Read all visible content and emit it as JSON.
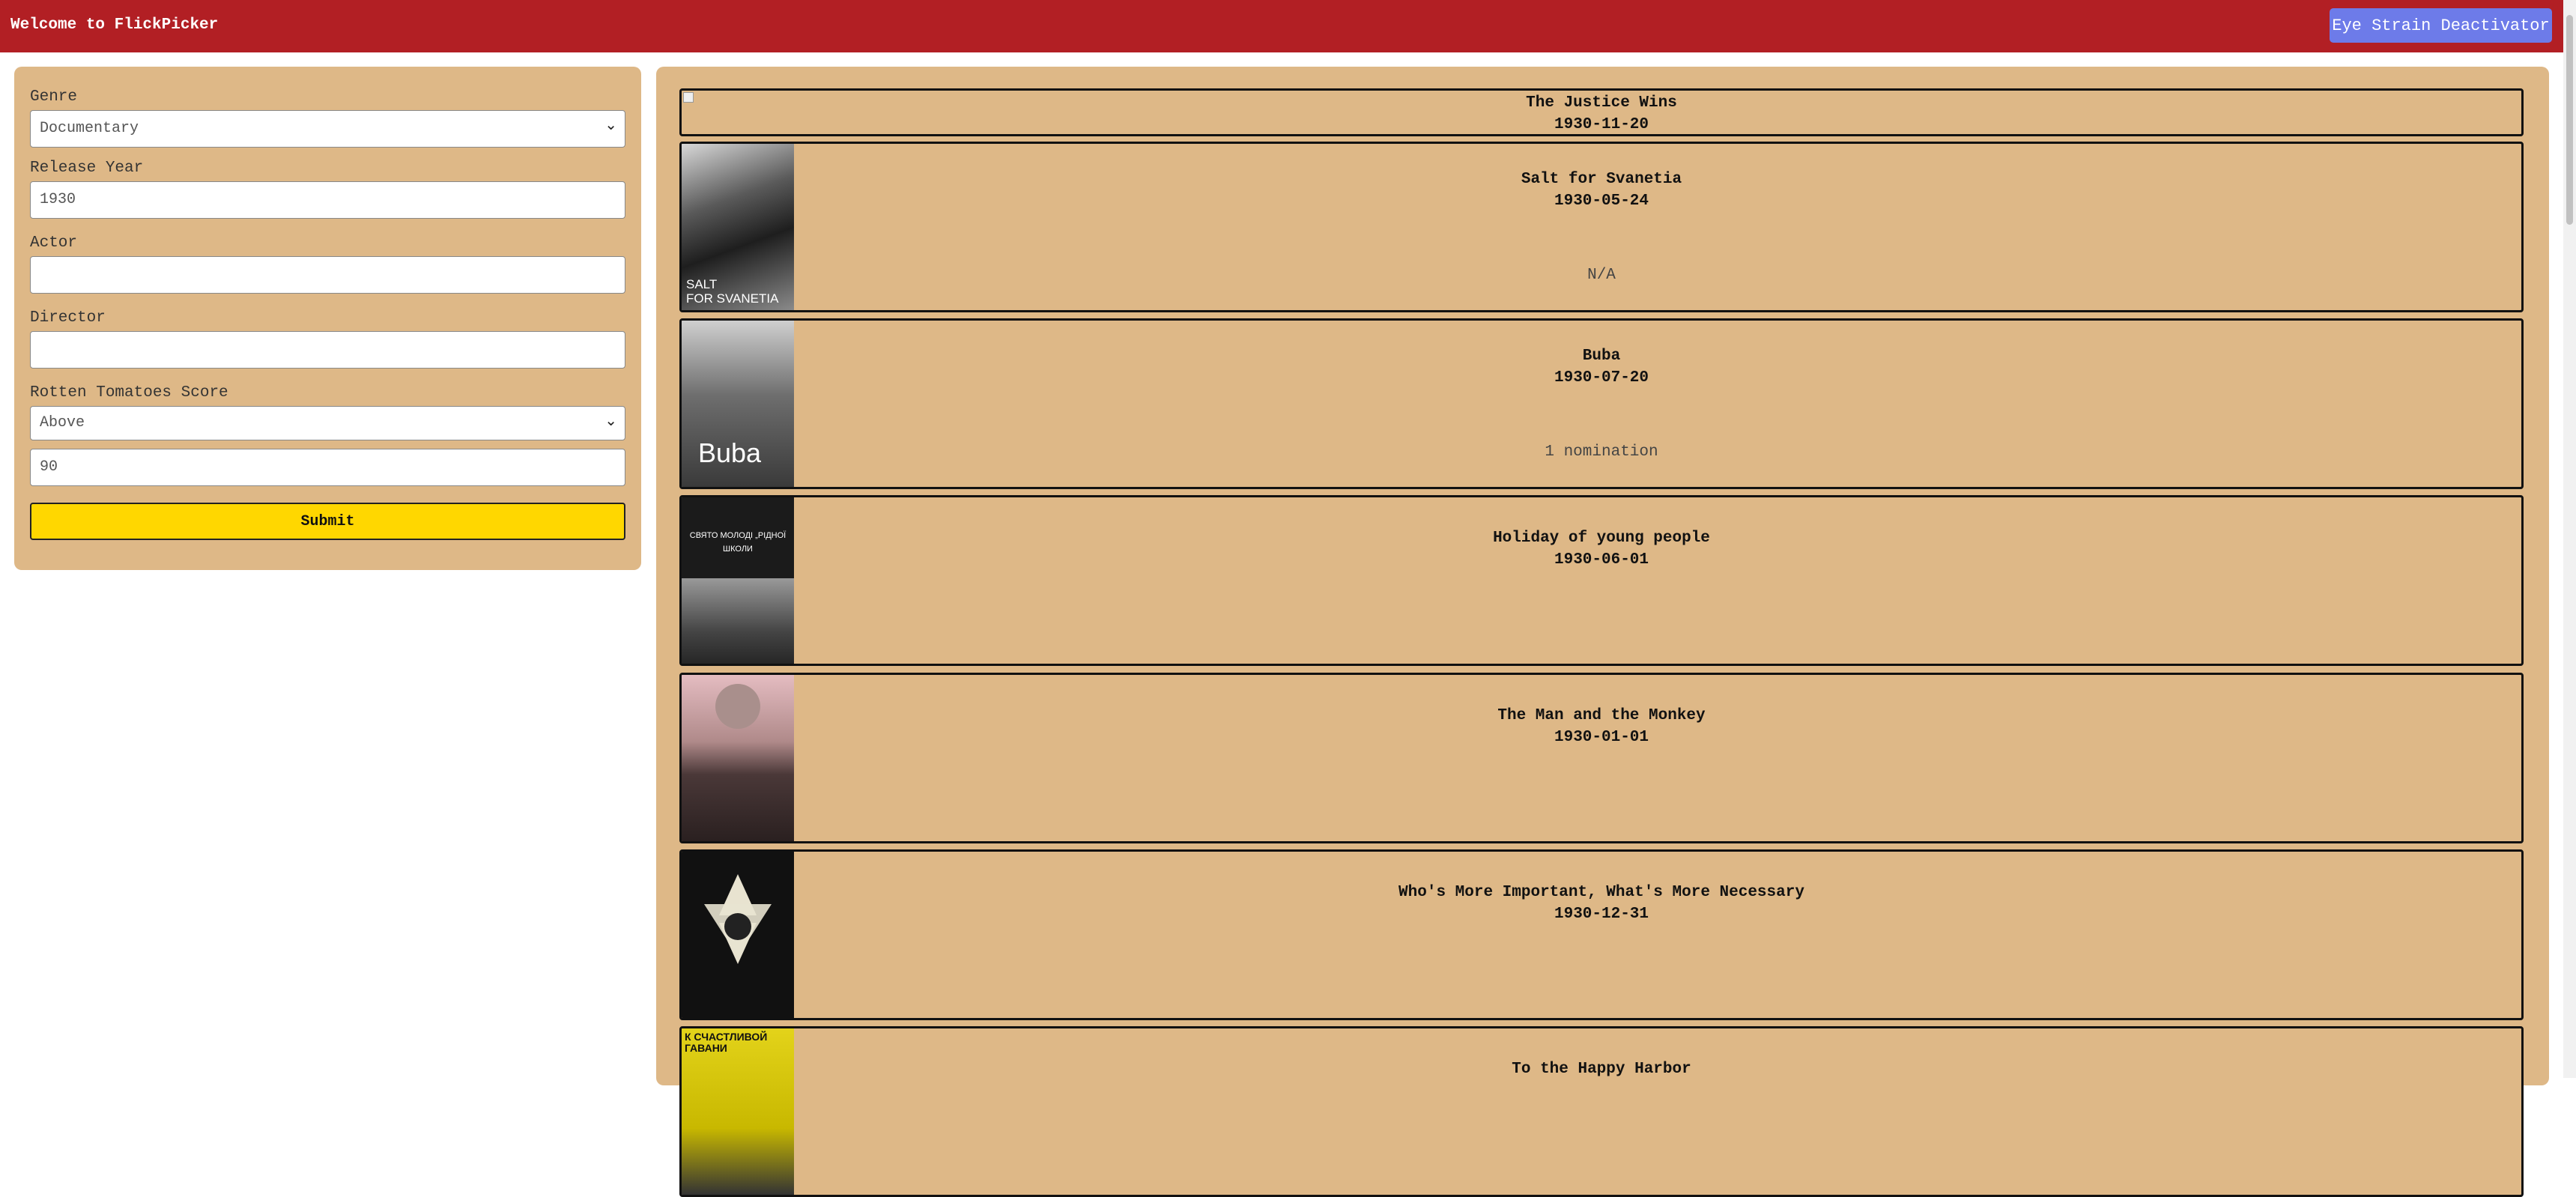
{
  "header": {
    "title": "Welcome to FlickPicker",
    "eye_button": "Eye Strain Deactivator"
  },
  "filters": {
    "genre_label": "Genre",
    "genre_value": "Documentary",
    "year_label": "Release Year",
    "year_value": "1930",
    "actor_label": "Actor",
    "actor_value": "",
    "director_label": "Director",
    "director_value": "",
    "rt_label": "Rotten Tomatoes Score",
    "rt_mode": "Above",
    "rt_value": "90",
    "submit": "Submit"
  },
  "movies": [
    {
      "title": "The Justice Wins",
      "date": "1930-11-20",
      "note": ""
    },
    {
      "title": "Salt for Svanetia",
      "date": "1930-05-24",
      "note": "N/A",
      "poster_text": "SALT\nFOR SVANETIA"
    },
    {
      "title": "Buba",
      "date": "1930-07-20",
      "note": "1 nomination",
      "poster_text": "Buba"
    },
    {
      "title": "Holiday of young people",
      "date": "1930-06-01",
      "note": "",
      "poster_text": "СВЯТО МОЛОДІ „РІДНОЇ ШКОЛИ"
    },
    {
      "title": "The Man and the Monkey",
      "date": "1930-01-01",
      "note": ""
    },
    {
      "title": "Who's More Important, What's More Necessary",
      "date": "1930-12-31",
      "note": ""
    },
    {
      "title": "To the Happy Harbor",
      "date": "",
      "note": "",
      "poster_text": "К СЧАСТЛИВОЙ ГАВАНИ"
    }
  ]
}
